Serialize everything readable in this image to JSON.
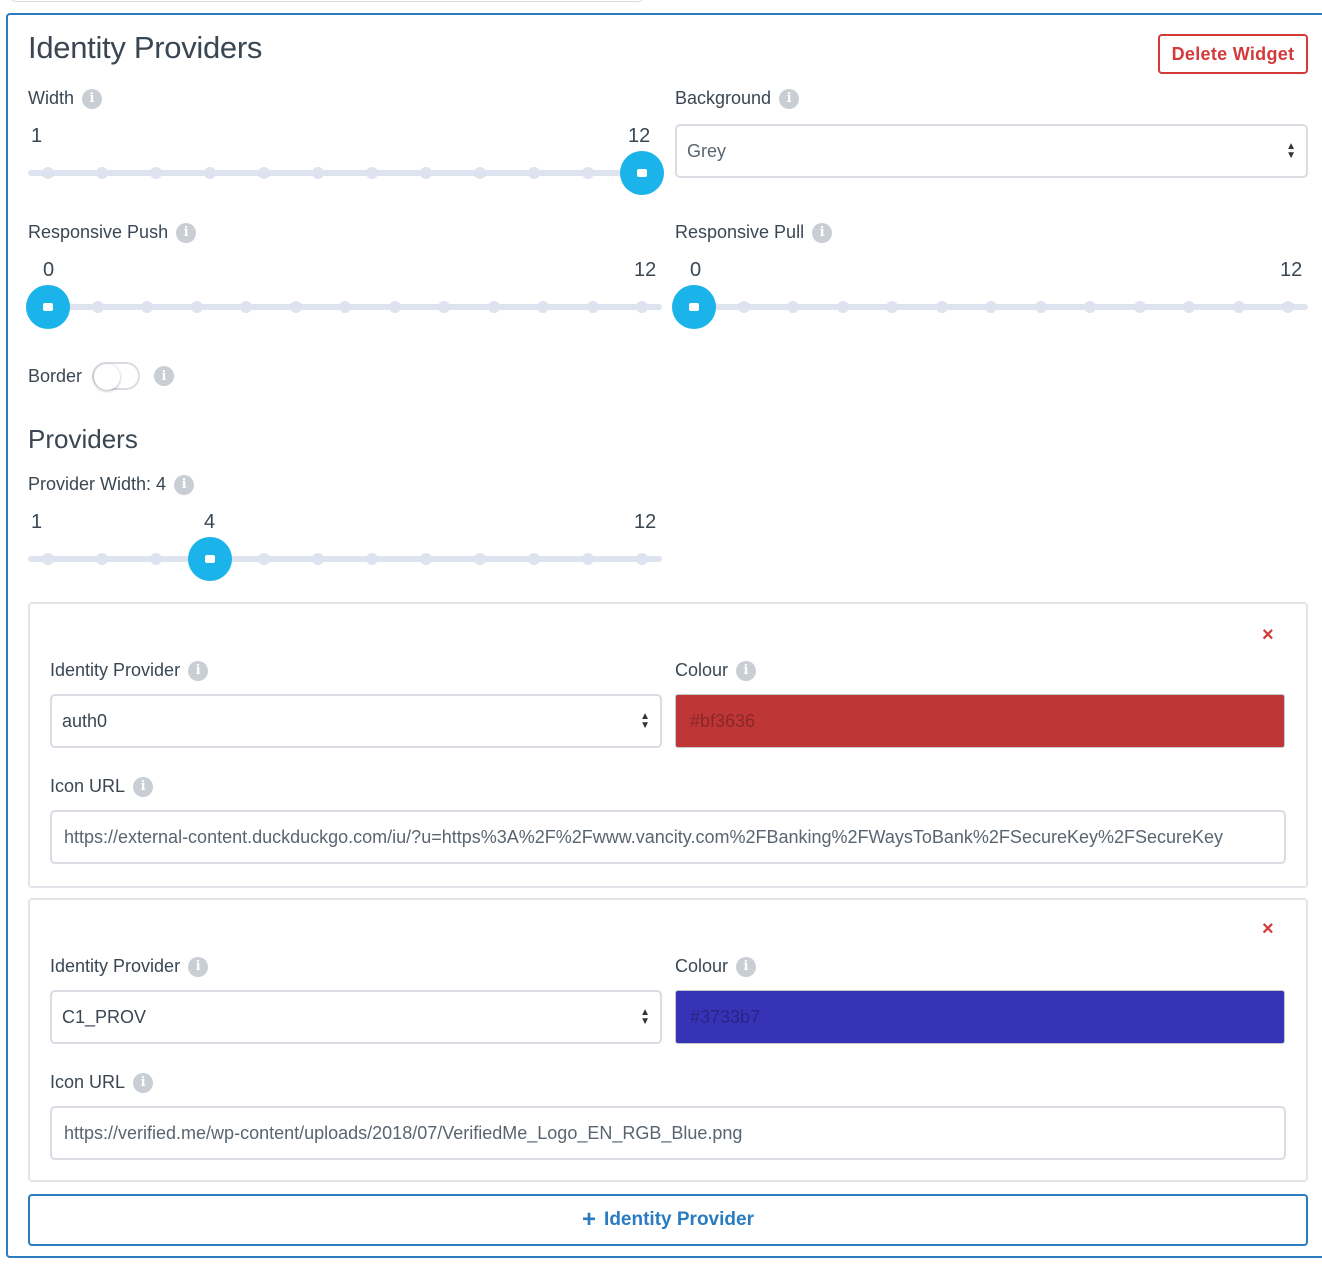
{
  "widget": {
    "title": "Identity Providers",
    "delete_label": "Delete Widget"
  },
  "width": {
    "label": "Width",
    "min": 1,
    "max": 12,
    "value": 12,
    "min_label": "1",
    "max_label": "12"
  },
  "background": {
    "label": "Background",
    "selected": "Grey"
  },
  "responsive_push": {
    "label": "Responsive Push",
    "min": 0,
    "max": 12,
    "value": 0,
    "min_label": "0",
    "max_label": "12"
  },
  "responsive_pull": {
    "label": "Responsive Pull",
    "min": 0,
    "max": 12,
    "value": 0,
    "min_label": "0",
    "max_label": "12"
  },
  "border": {
    "label": "Border",
    "on": false
  },
  "providers_section": {
    "title": "Providers",
    "width_label": "Provider Width: 4",
    "min": 1,
    "max": 12,
    "value": 4,
    "min_label": "1",
    "value_label": "4",
    "max_label": "12"
  },
  "providers": [
    {
      "provider_label": "Identity Provider",
      "provider_value": "auth0",
      "colour_label": "Colour",
      "colour_value": "#bf3636",
      "icon_label": "Icon URL",
      "icon_url": "https://external-content.duckduckgo.com/iu/?u=https%3A%2F%2Fwww.vancity.com%2FBanking%2FWaysToBank%2FSecureKey%2FSecureKey"
    },
    {
      "provider_label": "Identity Provider",
      "provider_value": "C1_PROV",
      "colour_label": "Colour",
      "colour_value": "#3733b7",
      "icon_label": "Icon URL",
      "icon_url": "https://verified.me/wp-content/uploads/2018/07/VerifiedMe_Logo_EN_RGB_Blue.png"
    }
  ],
  "add_provider": {
    "plus": "+",
    "label": "Identity Provider"
  },
  "colors": {
    "accent": "#2a7bc0",
    "danger": "#d33a3a",
    "slider_handle": "#1ab3ea",
    "slider_track": "#dde3ef"
  },
  "icons": {
    "info": "info-icon",
    "close": "close-icon",
    "select": "updown-icon",
    "add": "plus-icon"
  }
}
